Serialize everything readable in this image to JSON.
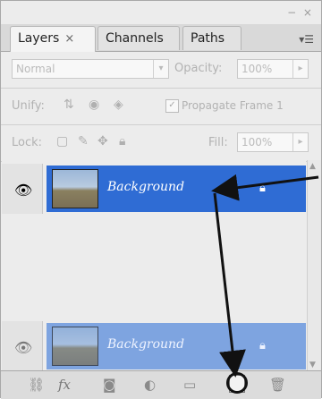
{
  "panel": {
    "controls": "− ×",
    "menu_icon": "panel-menu-icon"
  },
  "tabs": [
    {
      "label": "Layers",
      "close": "×",
      "active": true
    },
    {
      "label": "Channels",
      "active": false
    },
    {
      "label": "Paths",
      "active": false
    }
  ],
  "blend": {
    "mode": "Normal",
    "opacity_label": "Opacity:",
    "opacity_value": "100%"
  },
  "unify": {
    "label": "Unify:",
    "propagate_label": "Propagate Frame 1",
    "propagate_checked": true
  },
  "lock": {
    "label": "Lock:",
    "fill_label": "Fill:",
    "fill_value": "100%"
  },
  "layers": [
    {
      "name": "Background",
      "selected": true,
      "color": "#2f6cd4"
    },
    {
      "name": "Background",
      "selected": false,
      "color": "#7ea4e0"
    }
  ],
  "bottom_icons": [
    "link-icon",
    "fx-icon",
    "mask-icon",
    "adjustment-icon",
    "group-folder-icon",
    "new-layer-icon",
    "trash-icon"
  ],
  "bottom_fx_text": "fx"
}
